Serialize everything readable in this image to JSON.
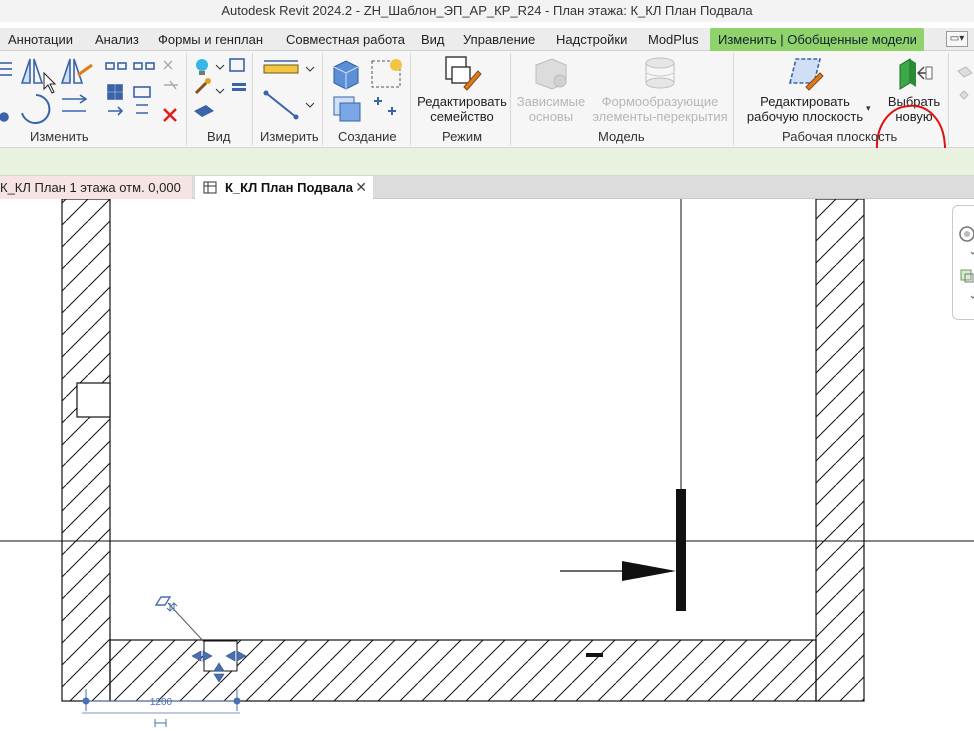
{
  "app": {
    "title": "Autodesk Revit 2024.2 - ZH_Шаблон_ЭП_АР_КР_R24 - План этажа: К_КЛ План Подвала"
  },
  "ribbon_tabs": [
    {
      "label": "Аннотации"
    },
    {
      "label": "Анализ"
    },
    {
      "label": "Формы и генплан"
    },
    {
      "label": "Совместная работа"
    },
    {
      "label": "Вид"
    },
    {
      "label": "Управление"
    },
    {
      "label": "Надстройки"
    },
    {
      "label": "ModPlus"
    },
    {
      "label": "Изменить | Обобщенные модели"
    }
  ],
  "panels": {
    "modify": "Изменить",
    "view": "Вид",
    "measure": "Измерить",
    "create": "Создание",
    "mode": "Режим",
    "model": "Модель",
    "workplane": "Рабочая плоскость"
  },
  "buttons": {
    "edit_family": "Редактировать\nсемейство",
    "dependent_bases": "Зависимые\nосновы",
    "form_elements": "Формообразующие\nэлементы-перекрытия",
    "edit_workplane": "Редактировать\nрабочую плоскость",
    "pick_new": "Выбрать\nновую"
  },
  "view_tabs": [
    {
      "label": "К_КЛ План 1 этажа отм. 0,000",
      "active": false
    },
    {
      "label": "К_КЛ План Подвала",
      "active": true
    }
  ],
  "view_tab_close": "✕",
  "drawing": {
    "dimension_value": "1200"
  },
  "colors": {
    "contextual_tab": "#8fd36a",
    "annotation_circle": "#e01010",
    "grip_blue": "#4a6fb5",
    "options_bar": "#e9f1df"
  }
}
